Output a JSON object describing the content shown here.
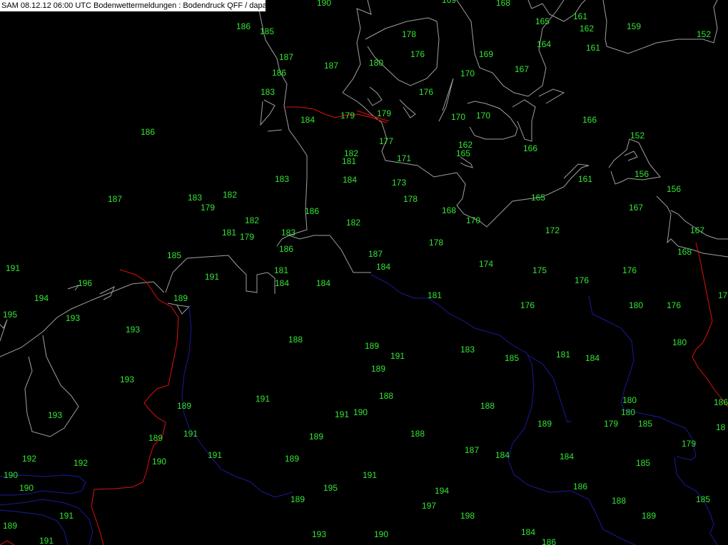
{
  "header": {
    "title": "SAM 08.12.12 06:00 UTC  Bodenwettermeldungen :  Bodendruck QFF / dapa"
  },
  "colors": {
    "background": "#000000",
    "station_text": "#33e633",
    "coastline": "#a0a0a0",
    "border": "#e01010",
    "river": "#1a1a9a",
    "title_bg": "#ffffff"
  },
  "stations": [
    {
      "value": "190"
    },
    {
      "value": "169"
    },
    {
      "value": "168"
    },
    {
      "value": "165"
    },
    {
      "value": "161"
    },
    {
      "value": "162"
    },
    {
      "value": "159"
    },
    {
      "value": "152"
    },
    {
      "value": "186"
    },
    {
      "value": "185"
    },
    {
      "value": "178"
    },
    {
      "value": "176"
    },
    {
      "value": "169"
    },
    {
      "value": "164"
    },
    {
      "value": "161"
    },
    {
      "value": "187"
    },
    {
      "value": "187"
    },
    {
      "value": "180"
    },
    {
      "value": "186"
    },
    {
      "value": "170"
    },
    {
      "value": "167"
    },
    {
      "value": "183"
    },
    {
      "value": "176"
    },
    {
      "value": "184"
    },
    {
      "value": "179"
    },
    {
      "value": "179"
    },
    {
      "value": "170"
    },
    {
      "value": "170"
    },
    {
      "value": "166"
    },
    {
      "value": "186"
    },
    {
      "value": "152"
    },
    {
      "value": "177"
    },
    {
      "value": "162"
    },
    {
      "value": "165"
    },
    {
      "value": "166"
    },
    {
      "value": "182"
    },
    {
      "value": "181"
    },
    {
      "value": "171"
    },
    {
      "value": "156"
    },
    {
      "value": "183"
    },
    {
      "value": "184"
    },
    {
      "value": "173"
    },
    {
      "value": "161"
    },
    {
      "value": "187"
    },
    {
      "value": "183"
    },
    {
      "value": "182"
    },
    {
      "value": "178"
    },
    {
      "value": "165"
    },
    {
      "value": "156"
    },
    {
      "value": "179"
    },
    {
      "value": "186"
    },
    {
      "value": "168"
    },
    {
      "value": "167"
    },
    {
      "value": "182"
    },
    {
      "value": "182"
    },
    {
      "value": "170"
    },
    {
      "value": "181"
    },
    {
      "value": "183"
    },
    {
      "value": "179"
    },
    {
      "value": "172"
    },
    {
      "value": "167"
    },
    {
      "value": "186"
    },
    {
      "value": "178"
    },
    {
      "value": "168"
    },
    {
      "value": "185"
    },
    {
      "value": "187"
    },
    {
      "value": "191"
    },
    {
      "value": "174"
    },
    {
      "value": "181"
    },
    {
      "value": "184"
    },
    {
      "value": "175"
    },
    {
      "value": "176"
    },
    {
      "value": "191"
    },
    {
      "value": "184"
    },
    {
      "value": "184"
    },
    {
      "value": "196"
    },
    {
      "value": "176"
    },
    {
      "value": "194"
    },
    {
      "value": "189"
    },
    {
      "value": "181"
    },
    {
      "value": "17"
    },
    {
      "value": "195"
    },
    {
      "value": "176"
    },
    {
      "value": "180"
    },
    {
      "value": "176"
    },
    {
      "value": "193"
    },
    {
      "value": "193"
    },
    {
      "value": "188"
    },
    {
      "value": "180"
    },
    {
      "value": "189"
    },
    {
      "value": "191"
    },
    {
      "value": "183"
    },
    {
      "value": "185"
    },
    {
      "value": "181"
    },
    {
      "value": "184"
    },
    {
      "value": "189"
    },
    {
      "value": "193"
    },
    {
      "value": "188"
    },
    {
      "value": "191"
    },
    {
      "value": "180"
    },
    {
      "value": "186"
    },
    {
      "value": "189"
    },
    {
      "value": "188"
    },
    {
      "value": "193"
    },
    {
      "value": "190"
    },
    {
      "value": "180"
    },
    {
      "value": "18"
    },
    {
      "value": "189"
    },
    {
      "value": "179"
    },
    {
      "value": "185"
    },
    {
      "value": "191"
    },
    {
      "value": "188"
    },
    {
      "value": "189"
    },
    {
      "value": "189"
    },
    {
      "value": "187"
    },
    {
      "value": "179"
    },
    {
      "value": "191"
    },
    {
      "value": "184"
    },
    {
      "value": "184"
    },
    {
      "value": "189"
    },
    {
      "value": "192"
    },
    {
      "value": "192"
    },
    {
      "value": "190"
    },
    {
      "value": "185"
    },
    {
      "value": "191"
    },
    {
      "value": "190"
    },
    {
      "value": "186"
    },
    {
      "value": "190"
    },
    {
      "value": "195"
    },
    {
      "value": "194"
    },
    {
      "value": "189"
    },
    {
      "value": "185"
    },
    {
      "value": "188"
    },
    {
      "value": "191"
    },
    {
      "value": "197"
    },
    {
      "value": "198"
    },
    {
      "value": "189"
    },
    {
      "value": "189"
    },
    {
      "value": "191"
    },
    {
      "value": "193"
    },
    {
      "value": "190"
    },
    {
      "value": "184"
    },
    {
      "value": "191"
    },
    {
      "value": "186"
    }
  ]
}
